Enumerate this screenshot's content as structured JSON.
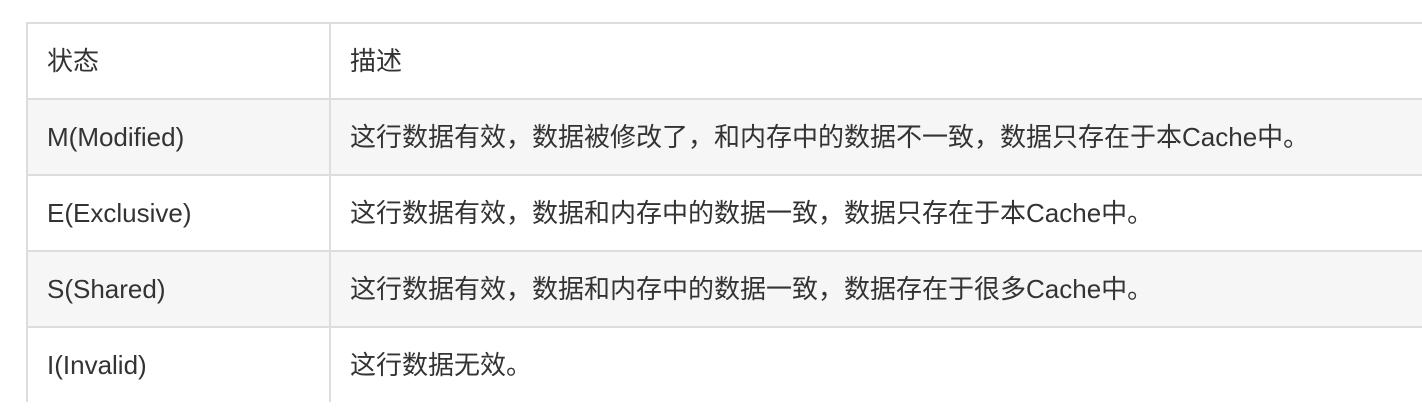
{
  "table": {
    "headers": [
      "状态",
      "描述"
    ],
    "rows": [
      {
        "state": "M(Modified)",
        "description": "这行数据有效，数据被修改了，和内存中的数据不一致，数据只存在于本Cache中。"
      },
      {
        "state": "E(Exclusive)",
        "description": "这行数据有效，数据和内存中的数据一致，数据只存在于本Cache中。"
      },
      {
        "state": "S(Shared)",
        "description": "这行数据有效，数据和内存中的数据一致，数据存在于很多Cache中。"
      },
      {
        "state": "I(Invalid)",
        "description": "这行数据无效。"
      }
    ]
  }
}
